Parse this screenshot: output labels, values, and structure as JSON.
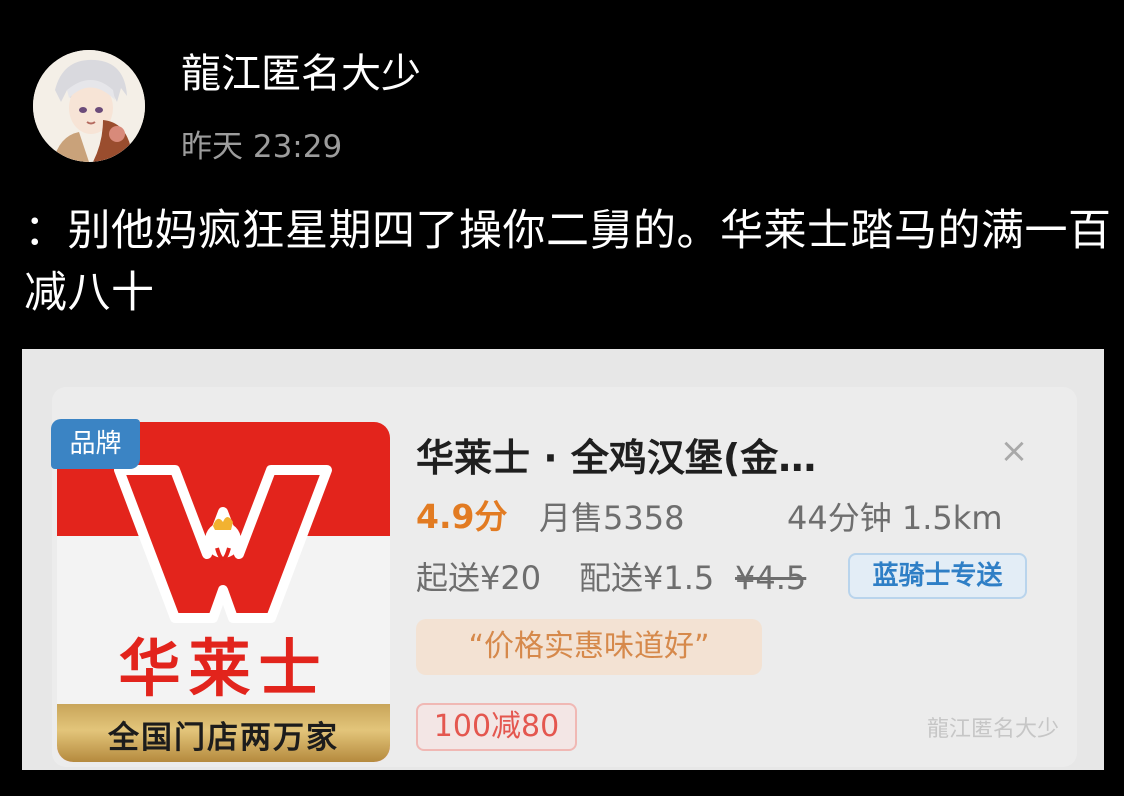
{
  "post": {
    "username": "龍江匿名大少",
    "timestamp": "昨天 23:29",
    "text": "：别他妈疯狂星期四了操你二舅的。华莱士踏马的满一百减八十"
  },
  "store_card": {
    "brand_badge": "品牌",
    "logo_name": "华莱士",
    "logo_banner": "全国门店两万家",
    "name": "华莱士 · 全鸡汉堡(金…",
    "close_icon": "close-icon",
    "rating": "4.9分",
    "monthly_sales": "月售5358",
    "eta": "44分钟 1.5km",
    "min_order": "起送¥20",
    "delivery_fee": "配送¥1.5",
    "delivery_fee_original": "¥4.5",
    "rider_tag": "蓝骑士专送",
    "slogan": "“价格实惠味道好”",
    "promo": "100减80",
    "watermark": "龍江匿名大少"
  },
  "colors": {
    "background": "#000000",
    "logo_red": "#e3241c",
    "rating_orange": "#e27b22",
    "rider_blue": "#2f7fc6",
    "promo_red": "#e4574f"
  }
}
